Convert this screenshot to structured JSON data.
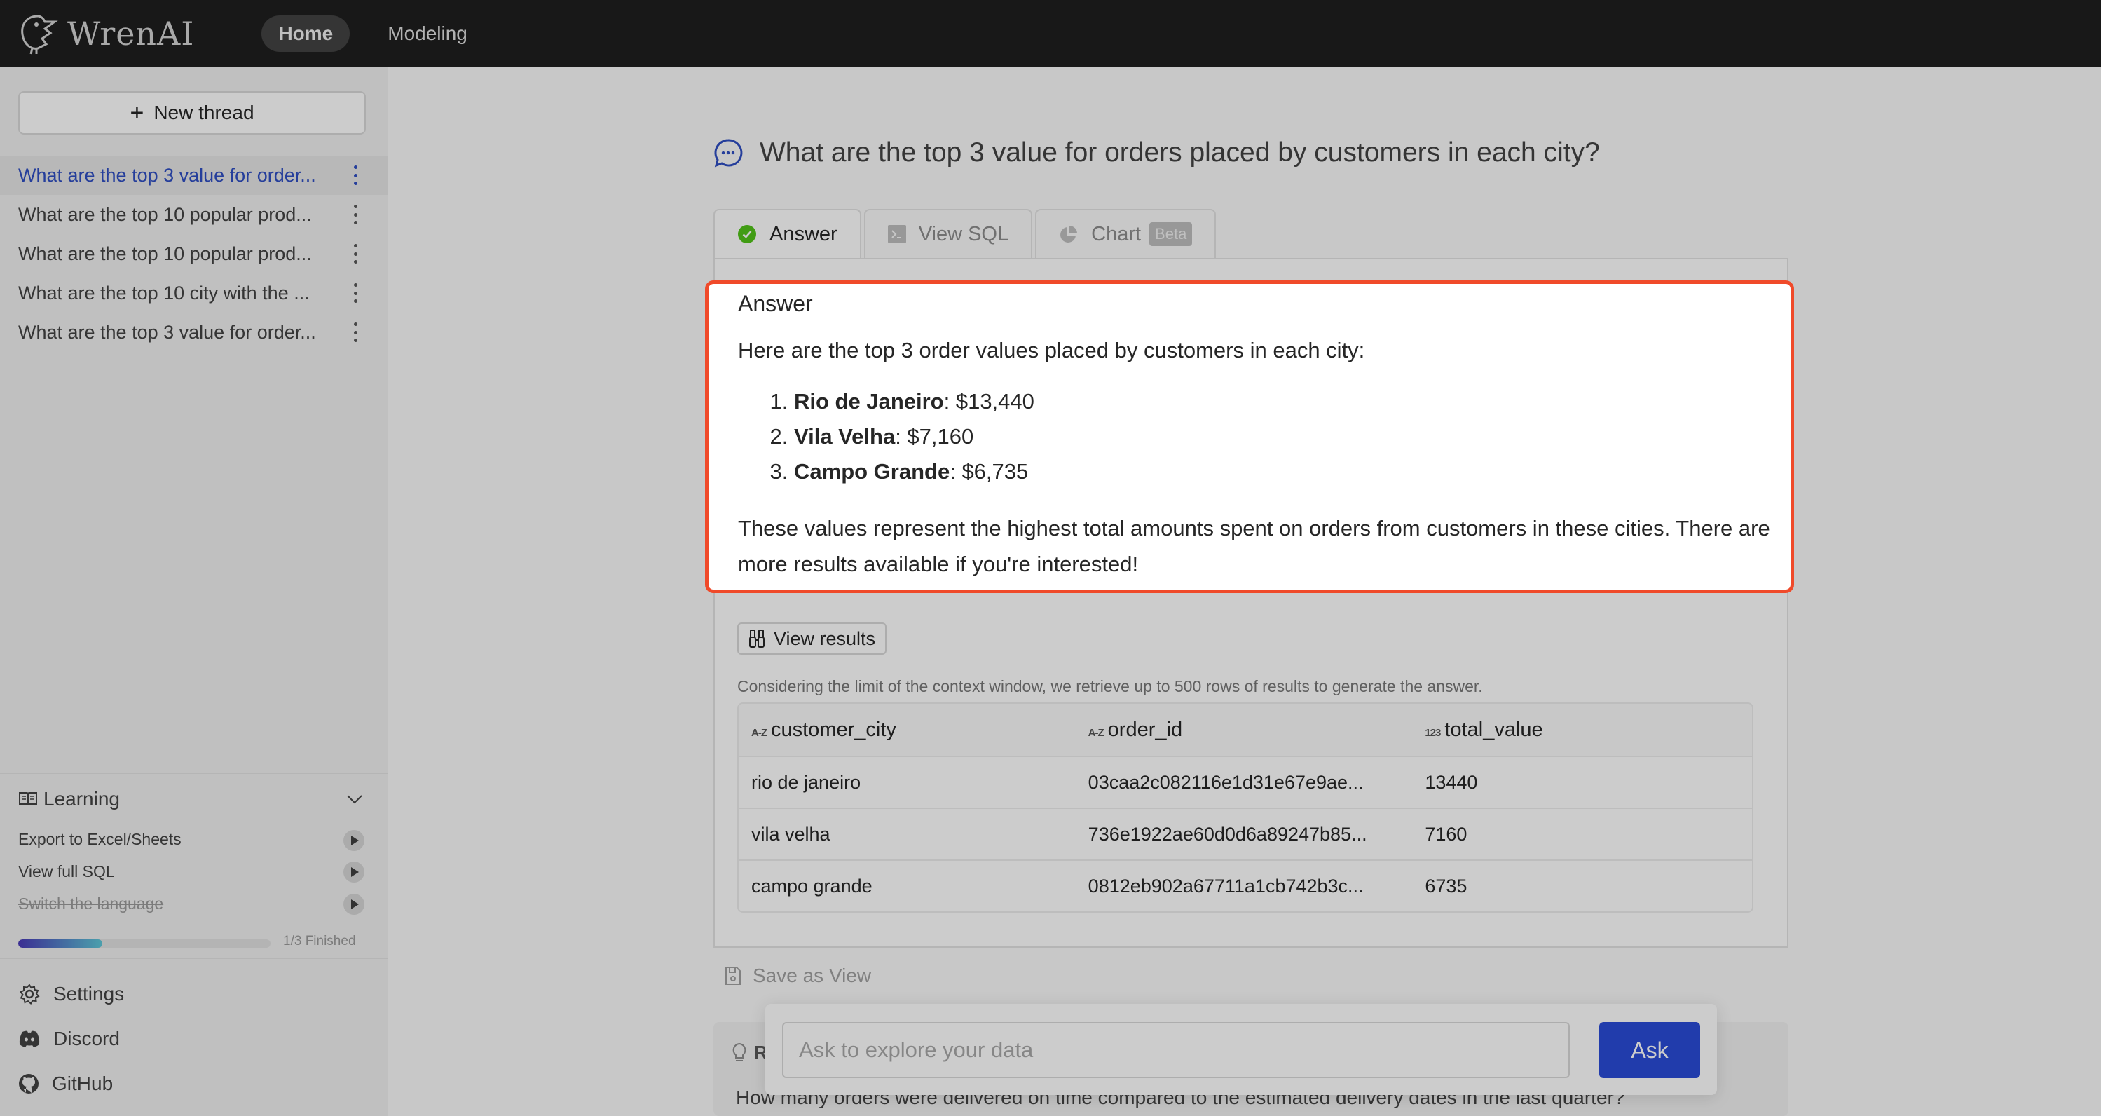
{
  "header": {
    "brand": "WrenAI",
    "nav": [
      {
        "label": "Home",
        "active": true
      },
      {
        "label": "Modeling",
        "active": false
      }
    ]
  },
  "sidebar": {
    "new_thread_label": "New thread",
    "threads": [
      {
        "label": "What are the top 3 value for order...",
        "active": true
      },
      {
        "label": "What are the top 10 popular prod...",
        "active": false
      },
      {
        "label": "What are the top 10 popular prod...",
        "active": false
      },
      {
        "label": "What are the top 10 city with the ...",
        "active": false
      },
      {
        "label": "What are the top 3 value for order...",
        "active": false
      }
    ],
    "learning": {
      "title": "Learning",
      "items": [
        {
          "label": "Export to Excel/Sheets",
          "done": false
        },
        {
          "label": "View full SQL",
          "done": false
        },
        {
          "label": "Switch the language",
          "done": true
        }
      ],
      "progress_fraction": 0.333,
      "progress_label": "1/3 Finished"
    },
    "links": [
      {
        "label": "Settings",
        "icon": "gear-icon"
      },
      {
        "label": "Discord",
        "icon": "discord-icon"
      },
      {
        "label": "GitHub",
        "icon": "github-icon"
      }
    ]
  },
  "main": {
    "question": "What are the top 3 value for orders placed by customers in each city?",
    "tabs": [
      {
        "label": "Answer",
        "icon": "check-circle-icon",
        "active": true
      },
      {
        "label": "View SQL",
        "icon": "terminal-icon",
        "active": false
      },
      {
        "label": "Chart",
        "icon": "pie-chart-icon",
        "badge": "Beta",
        "active": false
      }
    ],
    "answer": {
      "title": "Answer",
      "intro": "Here are the top 3 order values placed by customers in each city:",
      "items": [
        {
          "city": "Rio de Janeiro",
          "value": ": $13,440"
        },
        {
          "city": "Vila Velha",
          "value": ": $7,160"
        },
        {
          "city": "Campo Grande",
          "value": ": $6,735"
        }
      ],
      "outro": "These values represent the highest total amounts spent on orders from customers in these cities. There are more results available if you're interested!"
    },
    "view_results_label": "View results",
    "note": "Considering the limit of the context window, we retrieve up to 500 rows of results to generate the answer.",
    "table": {
      "columns": [
        {
          "type": "A-Z",
          "name": "customer_city"
        },
        {
          "type": "123",
          "name": "order_id",
          "type_label": "A-Z"
        },
        {
          "type": "123",
          "name": "total_value"
        }
      ],
      "column_types": [
        "A-Z",
        "A-Z",
        "123"
      ],
      "rows": [
        [
          "rio de janeiro",
          "03caa2c082116e1d31e67e9ae...",
          "13440"
        ],
        [
          "vila velha",
          "736e1922ae60d0d6a89247b85...",
          "7160"
        ],
        [
          "campo grande",
          "0812eb902a67711a1cb742b3c...",
          "6735"
        ]
      ]
    },
    "save_view_label": "Save as View",
    "recommend": {
      "title": "R",
      "question": "How many orders were delivered on time compared to the estimated delivery dates in the last quarter?"
    },
    "ask": {
      "placeholder": "Ask to explore your data",
      "value": "",
      "button": "Ask"
    }
  },
  "colors": {
    "accent": "#2a4bd7",
    "active_thread": "#2f4ec2",
    "highlight_border": "#f04a2a",
    "success": "#52c41a",
    "header_bg": "#1f1f1f"
  }
}
